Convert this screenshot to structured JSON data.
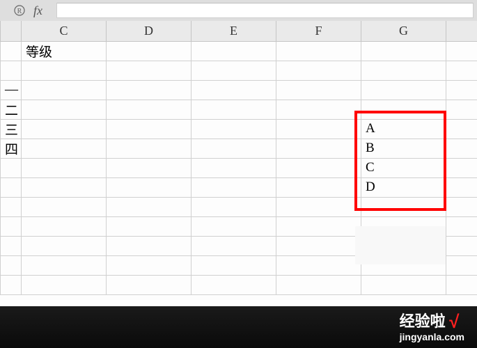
{
  "formula_bar": {
    "fx_label": "fx",
    "input_value": ""
  },
  "columns": {
    "partial": "",
    "c": "C",
    "d": "D",
    "e": "E",
    "f": "F",
    "g": "G",
    "right": ""
  },
  "rows": [
    {
      "partial": "",
      "c": "等级",
      "d": "",
      "e": "",
      "f": "",
      "g": ""
    },
    {
      "partial": "",
      "c": "",
      "d": "",
      "e": "",
      "f": "",
      "g": ""
    },
    {
      "partial": "—",
      "c": "",
      "d": "",
      "e": "",
      "f": "",
      "g": ""
    },
    {
      "partial": "二",
      "c": "",
      "d": "",
      "e": "",
      "f": "",
      "g": ""
    },
    {
      "partial": "三",
      "c": "",
      "d": "",
      "e": "",
      "f": "",
      "g": "A"
    },
    {
      "partial": "四",
      "c": "",
      "d": "",
      "e": "",
      "f": "",
      "g": "B"
    },
    {
      "partial": "",
      "c": "",
      "d": "",
      "e": "",
      "f": "",
      "g": "C"
    },
    {
      "partial": "",
      "c": "",
      "d": "",
      "e": "",
      "f": "",
      "g": "D"
    },
    {
      "partial": "",
      "c": "",
      "d": "",
      "e": "",
      "f": "",
      "g": ""
    },
    {
      "partial": "",
      "c": "",
      "d": "",
      "e": "",
      "f": "",
      "g": ""
    },
    {
      "partial": "",
      "c": "",
      "d": "",
      "e": "",
      "f": "",
      "g": ""
    },
    {
      "partial": "",
      "c": "",
      "d": "",
      "e": "",
      "f": "",
      "g": ""
    },
    {
      "partial": "",
      "c": "",
      "d": "",
      "e": "",
      "f": "",
      "g": ""
    }
  ],
  "watermark": {
    "main": "经验啦",
    "check": "√",
    "sub": "jingyanla.com"
  }
}
